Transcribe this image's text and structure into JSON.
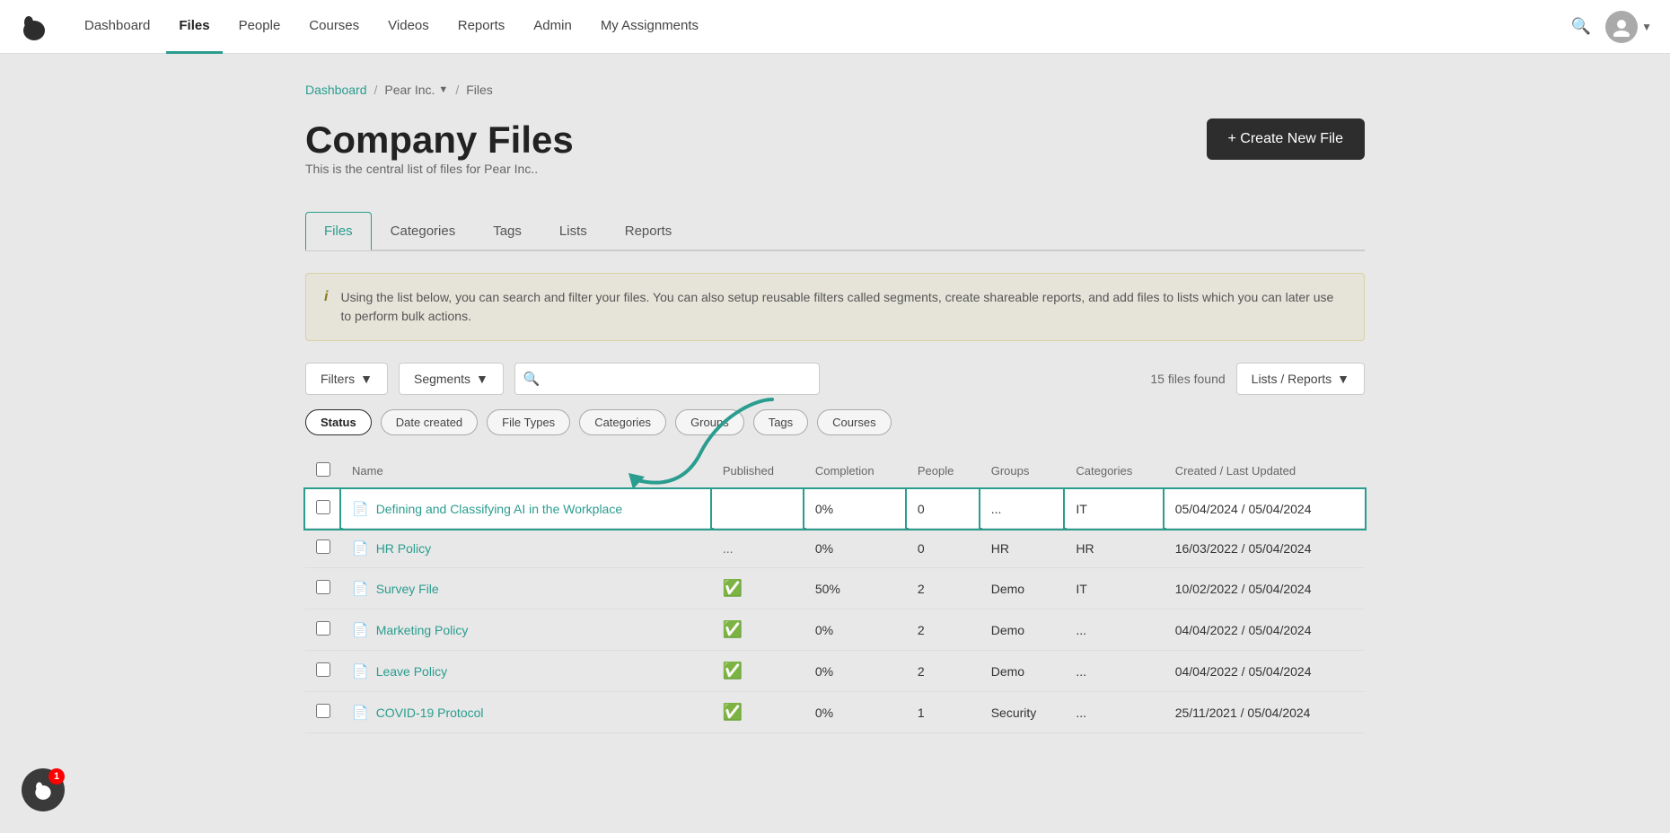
{
  "nav": {
    "logo_alt": "Eloomi Logo",
    "items": [
      {
        "label": "Dashboard",
        "active": false
      },
      {
        "label": "Files",
        "active": true
      },
      {
        "label": "People",
        "active": false
      },
      {
        "label": "Courses",
        "active": false
      },
      {
        "label": "Videos",
        "active": false
      },
      {
        "label": "Reports",
        "active": false
      },
      {
        "label": "Admin",
        "active": false
      },
      {
        "label": "My Assignments",
        "active": false
      }
    ]
  },
  "breadcrumb": {
    "dashboard": "Dashboard",
    "company": "Pear Inc.",
    "current": "Files"
  },
  "page": {
    "title": "Company Files",
    "subtitle": "This is the central list of files for Pear Inc..",
    "create_btn": "+ Create New File"
  },
  "tabs": [
    {
      "label": "Files",
      "active": true
    },
    {
      "label": "Categories",
      "active": false
    },
    {
      "label": "Tags",
      "active": false
    },
    {
      "label": "Lists",
      "active": false
    },
    {
      "label": "Reports",
      "active": false
    }
  ],
  "info": {
    "icon": "i",
    "text": "Using the list below, you can search and filter your files. You can also setup reusable filters called segments, create shareable reports, and add files to lists which you can later use to perform bulk actions."
  },
  "filters": {
    "filter_label": "Filters",
    "segments_label": "Segments",
    "search_placeholder": "",
    "files_found": "15 files found",
    "lists_reports": "Lists / Reports"
  },
  "pills": [
    {
      "label": "Status",
      "active": true
    },
    {
      "label": "Date created",
      "active": false
    },
    {
      "label": "File Types",
      "active": false
    },
    {
      "label": "Categories",
      "active": false
    },
    {
      "label": "Groups",
      "active": false
    },
    {
      "label": "Tags",
      "active": false
    },
    {
      "label": "Courses",
      "active": false
    }
  ],
  "table": {
    "columns": [
      "Name",
      "Published",
      "Completion",
      "People",
      "Groups",
      "Categories",
      "Created / Last Updated"
    ],
    "rows": [
      {
        "name": "Defining and Classifying AI in the Workplace",
        "published": "",
        "completion": "0%",
        "people": "0",
        "groups": "...",
        "categories": "IT",
        "created": "05/04/2024 / 05/04/2024",
        "highlight": true,
        "check": false
      },
      {
        "name": "HR Policy",
        "published": "...",
        "completion": "0%",
        "people": "0",
        "groups": "HR",
        "categories": "HR",
        "created": "16/03/2022 / 05/04/2024",
        "highlight": false,
        "check": false
      },
      {
        "name": "Survey File",
        "published": "✓",
        "completion": "50%",
        "people": "2",
        "groups": "Demo",
        "categories": "IT",
        "created": "10/02/2022 / 05/04/2024",
        "highlight": false,
        "check": true
      },
      {
        "name": "Marketing Policy",
        "published": "✓",
        "completion": "0%",
        "people": "2",
        "groups": "Demo",
        "categories": "...",
        "created": "04/04/2022 / 05/04/2024",
        "highlight": false,
        "check": true
      },
      {
        "name": "Leave Policy",
        "published": "✓",
        "completion": "0%",
        "people": "2",
        "groups": "Demo",
        "categories": "...",
        "created": "04/04/2022 / 05/04/2024",
        "highlight": false,
        "check": true
      },
      {
        "name": "COVID-19 Protocol",
        "published": "✓",
        "completion": "0%",
        "people": "1",
        "groups": "Security",
        "categories": "...",
        "created": "25/11/2021 / 05/04/2024",
        "highlight": false,
        "check": true
      }
    ]
  },
  "notification": {
    "count": "1"
  }
}
